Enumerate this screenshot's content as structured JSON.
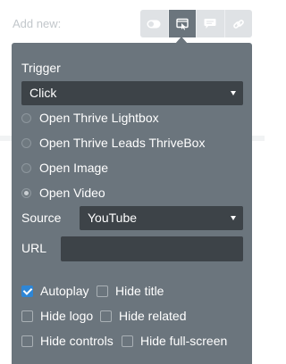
{
  "header": {
    "add_new_label": "Add new:"
  },
  "type_buttons": [
    {
      "icon": "toggle-icon",
      "active": false
    },
    {
      "icon": "lightbox-icon",
      "active": true
    },
    {
      "icon": "speech-bubble-icon",
      "active": false
    },
    {
      "icon": "link-icon",
      "active": false
    }
  ],
  "trigger": {
    "label": "Trigger",
    "selected": "Click"
  },
  "actions": [
    {
      "label": "Open Thrive Lightbox",
      "selected": false
    },
    {
      "label": "Open Thrive Leads ThriveBox",
      "selected": false
    },
    {
      "label": "Open Image",
      "selected": false
    },
    {
      "label": "Open Video",
      "selected": true
    }
  ],
  "source": {
    "label": "Source",
    "selected": "YouTube"
  },
  "url": {
    "label": "URL",
    "value": ""
  },
  "options": [
    {
      "label": "Autoplay",
      "checked": true
    },
    {
      "label": "Hide title",
      "checked": false
    },
    {
      "label": "Hide logo",
      "checked": false
    },
    {
      "label": "Hide related",
      "checked": false
    },
    {
      "label": "Hide controls",
      "checked": false
    },
    {
      "label": "Hide full-screen",
      "checked": false
    }
  ],
  "colors": {
    "panel": "#6b757d",
    "field": "#3d4348",
    "accent": "#2e86d6"
  }
}
